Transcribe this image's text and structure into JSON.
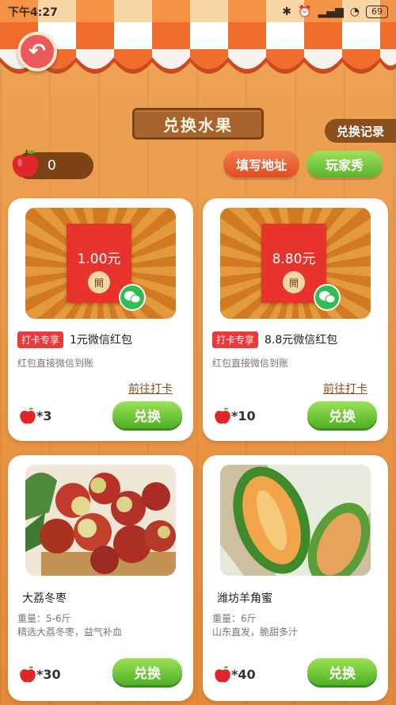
{
  "status": {
    "time": "下午4:27",
    "battery": "69"
  },
  "header": {
    "title": "兑换水果",
    "history": "兑换记录",
    "balance": "0",
    "fill_address": "填写地址",
    "player_show": "玩家秀"
  },
  "cards": [
    {
      "tag": "打卡专享",
      "name": "1元微信红包",
      "amount": "1.00元",
      "open_label": "開",
      "desc": "红包直接微信到账",
      "goto": "前往打卡",
      "cost": "*3",
      "button": "兑换"
    },
    {
      "tag": "打卡专享",
      "name": "8.8元微信红包",
      "amount": "8.80元",
      "open_label": "開",
      "desc": "红包直接微信到账",
      "goto": "前往打卡",
      "cost": "*10",
      "button": "兑换"
    },
    {
      "name": "大荔冬枣",
      "desc1": "重量：5-6斤",
      "desc2": "精选大荔冬枣，益气补血",
      "cost": "*30",
      "button": "兑换"
    },
    {
      "name": "潍坊羊角蜜",
      "desc1": "重量：6斤",
      "desc2": "山东直发，脆甜多汁",
      "cost": "*40",
      "button": "兑换"
    }
  ]
}
